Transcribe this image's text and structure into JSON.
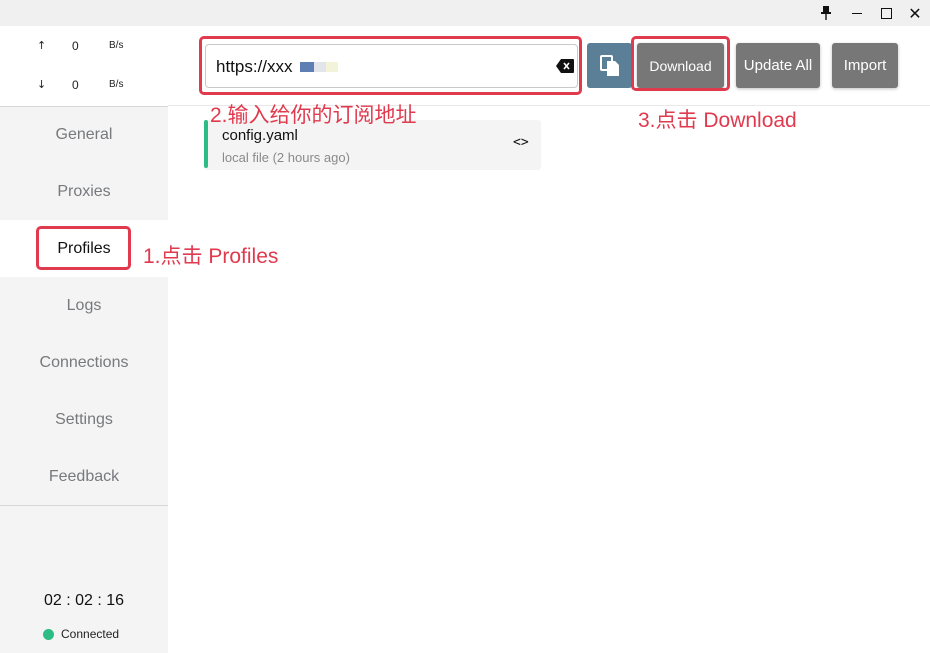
{
  "window": {
    "pin_icon": "pin-icon",
    "minimize_icon": "minimize-icon",
    "maximize_icon": "maximize-icon",
    "close_icon": "close-icon",
    "close_glyph": "✕",
    "pin_glyph": "📌"
  },
  "traffic": {
    "up_arrow": "↑",
    "up_value": "0",
    "up_unit": "B/s",
    "down_arrow": "↓",
    "down_value": "0",
    "down_unit": "B/s"
  },
  "sidebar": {
    "items": [
      {
        "label": "General"
      },
      {
        "label": "Proxies"
      },
      {
        "label": "Profiles",
        "active": true
      },
      {
        "label": "Logs"
      },
      {
        "label": "Connections"
      },
      {
        "label": "Settings"
      },
      {
        "label": "Feedback"
      }
    ],
    "clock": "02 : 02 : 16",
    "status": "Connected",
    "status_color": "#2cbc85"
  },
  "toolbar": {
    "url_value": "https://xxx",
    "url_mask_colors": [
      "#5e7fb3",
      "#e2e5ea",
      "#f3f3da"
    ],
    "clear_icon": "backspace-clear-icon",
    "copy_icon": "paste-icon",
    "download_label": "Download",
    "update_all_label": "Update All",
    "import_label": "Import",
    "copy_button_color": "#5b7f97",
    "action_button_color": "#777777"
  },
  "profiles": [
    {
      "name": "config.yaml",
      "subtitle": "local file (2 hours ago)",
      "edit_glyph": "<>",
      "accent_color": "#2cbc85"
    }
  ],
  "annotations": {
    "step1": "1.点击 Profiles",
    "step2": "2.输入给你的订阅地址",
    "step3": "3.点击 Download",
    "color": "#e03a4e"
  }
}
